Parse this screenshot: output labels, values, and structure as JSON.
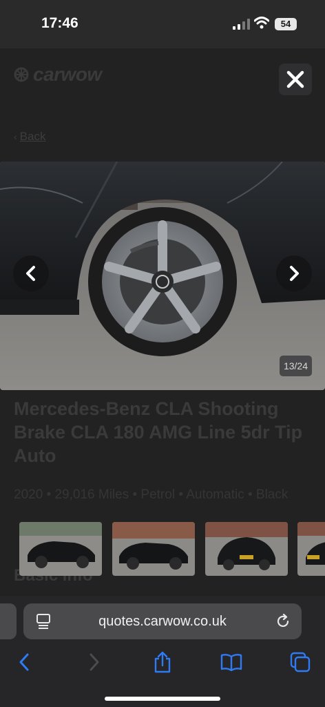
{
  "status_bar": {
    "time": "17:46",
    "battery": "54"
  },
  "page": {
    "logo": "carwow",
    "back_label": "Back",
    "photo_counter": "13/24",
    "title": "Mercedes-Benz CLA Shooting Brake CLA 180 AMG Line 5dr Tip Auto",
    "specs": "2020 • 29,016 Miles • Petrol • Automatic • Black",
    "section_heading": "Basic info"
  },
  "gallery": {
    "current": 13,
    "total": 24
  },
  "browser": {
    "url": "quotes.carwow.co.uk"
  },
  "icons": {
    "close": "close-icon",
    "prev": "chevron-left-icon",
    "next": "chevron-right-icon",
    "reload": "reload-icon",
    "share": "share-icon",
    "bookmarks": "book-icon",
    "tabs": "tabs-icon"
  },
  "colors": {
    "accent": "#2f7bf5",
    "overlay": "#1b1b1c"
  }
}
